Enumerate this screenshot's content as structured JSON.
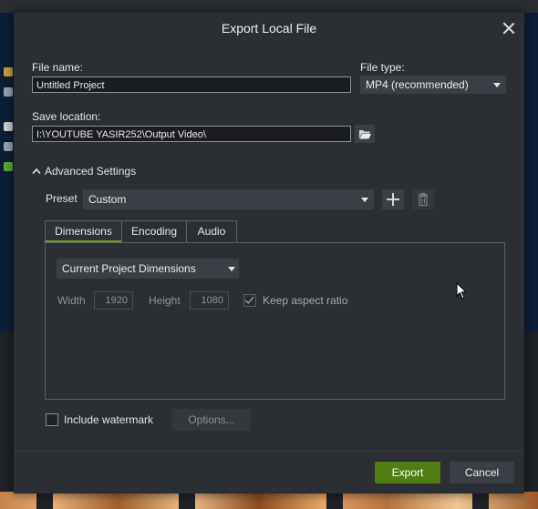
{
  "dialog": {
    "title": "Export Local File",
    "close_icon": "close-icon"
  },
  "file_name": {
    "label": "File name:",
    "value": "Untitled Project"
  },
  "file_type": {
    "label": "File type:",
    "value": "MP4 (recommended)"
  },
  "save_location": {
    "label": "Save location:",
    "value": "I:\\YOUTUBE YASIR252\\Output Video\\",
    "browse_icon": "folder-open-icon"
  },
  "advanced": {
    "label": "Advanced Settings",
    "expanded": true,
    "icon": "chevron-up-icon"
  },
  "preset": {
    "label": "Preset",
    "value": "Custom",
    "add_icon": "plus-icon",
    "delete_icon": "trash-icon"
  },
  "tabs": [
    {
      "label": "Dimensions",
      "active": true
    },
    {
      "label": "Encoding",
      "active": false
    },
    {
      "label": "Audio",
      "active": false
    }
  ],
  "dimensions": {
    "mode": "Current Project Dimensions",
    "width_label": "Width",
    "width_value": "1920",
    "height_label": "Height",
    "height_value": "1080",
    "keep_aspect_label": "Keep aspect ratio",
    "keep_aspect_checked": true
  },
  "watermark": {
    "label": "Include watermark",
    "checked": false,
    "options_label": "Options..."
  },
  "footer": {
    "export_label": "Export",
    "cancel_label": "Cancel"
  },
  "colors": {
    "dialog_bg": "#2b2e33",
    "accent_green": "#4f7d12",
    "tab_underline": "#6b9b26"
  }
}
